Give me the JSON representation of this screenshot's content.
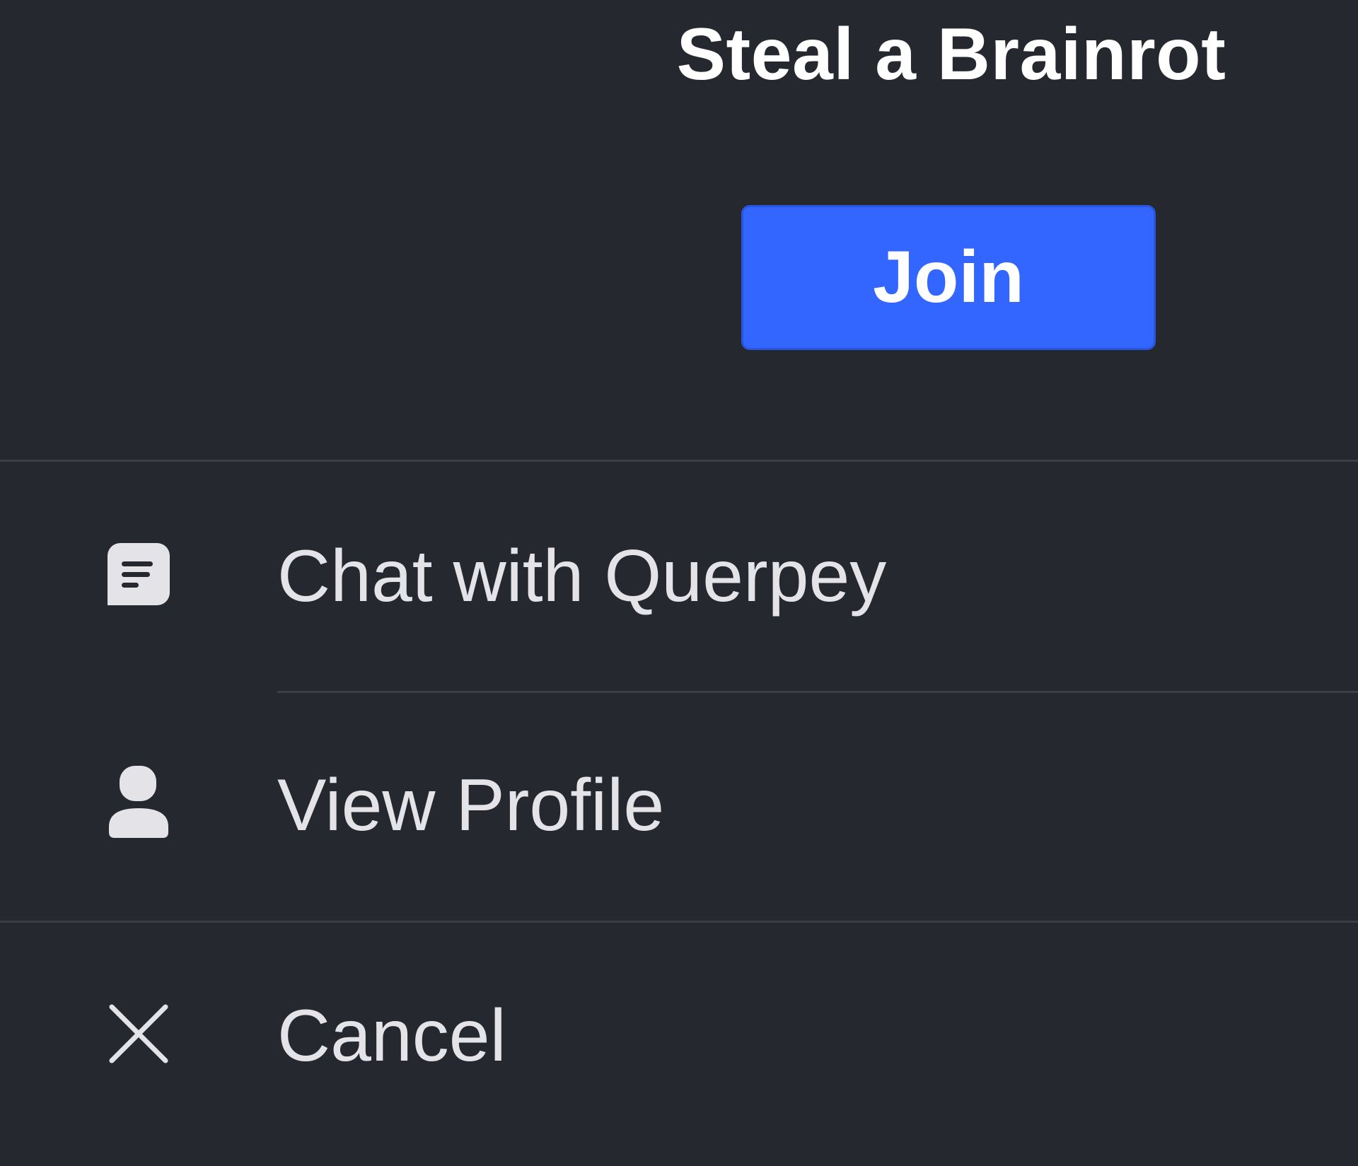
{
  "header": {
    "title": "Steal a Brainrot",
    "join_label": "Join"
  },
  "menu": {
    "items": [
      {
        "label": "Chat with Querpey",
        "icon": "chat-bubble-icon"
      },
      {
        "label": "View Profile",
        "icon": "person-icon"
      },
      {
        "label": "Cancel",
        "icon": "close-icon"
      }
    ]
  },
  "colors": {
    "background": "#262830",
    "accent": "#3366ff",
    "text": "#e4e4e8",
    "divider": "#3b3e47"
  }
}
